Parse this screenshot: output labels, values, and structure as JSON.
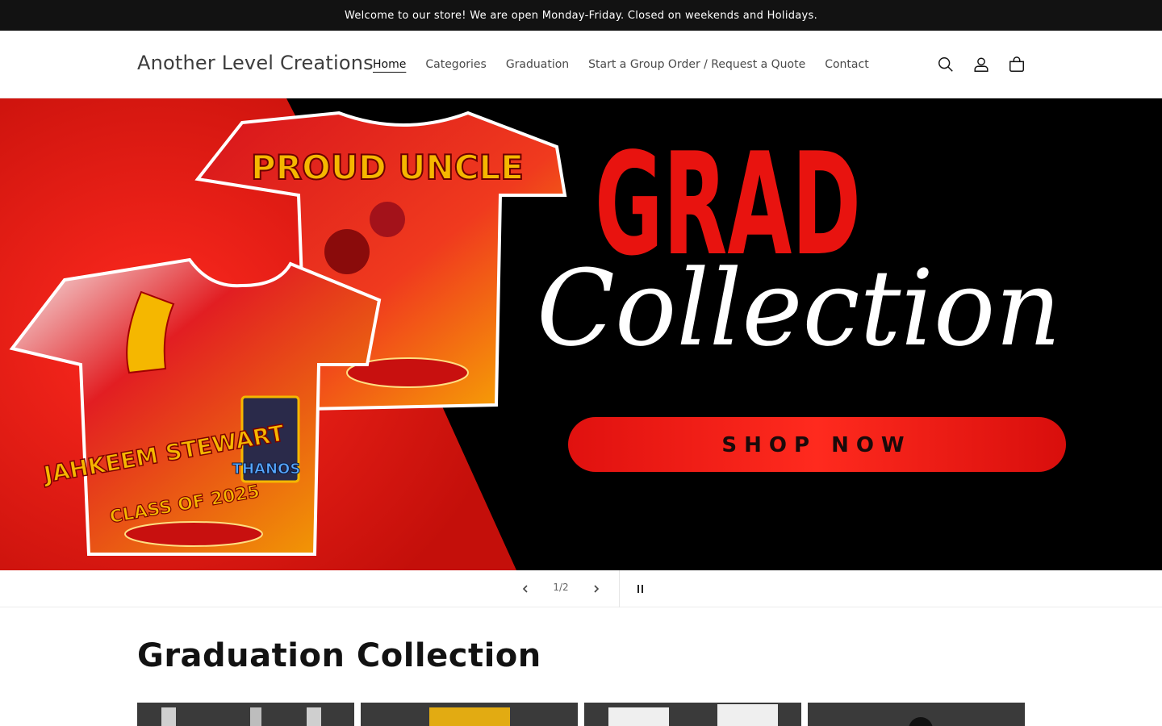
{
  "announcement": {
    "text": "Welcome to our store! We are open Monday-Friday. Closed on weekends and Holidays."
  },
  "header": {
    "logo": "Another Level Creations",
    "nav": [
      {
        "label": "Home",
        "active": true
      },
      {
        "label": "Categories",
        "active": false
      },
      {
        "label": "Graduation",
        "active": false
      },
      {
        "label": "Start a Group Order / Request a Quote",
        "active": false
      },
      {
        "label": "Contact",
        "active": false
      }
    ],
    "icons": [
      "search-icon",
      "account-icon",
      "cart-icon"
    ]
  },
  "hero": {
    "headline": "GRAD",
    "script": "Collection",
    "button": "SHOP NOW",
    "shirt_top_text": "PROUD UNCLE",
    "shirt_name": "JAHKEEM STEWART",
    "shirt_class": "CLASS OF 2025",
    "card_text": "THANOS",
    "colors": {
      "red": "#e41b17",
      "black": "#000000",
      "gold": "#f5b700",
      "white": "#ffffff"
    }
  },
  "slider": {
    "counter": "1/2"
  },
  "collection": {
    "title": "Graduation Collection",
    "product_count": 4
  }
}
